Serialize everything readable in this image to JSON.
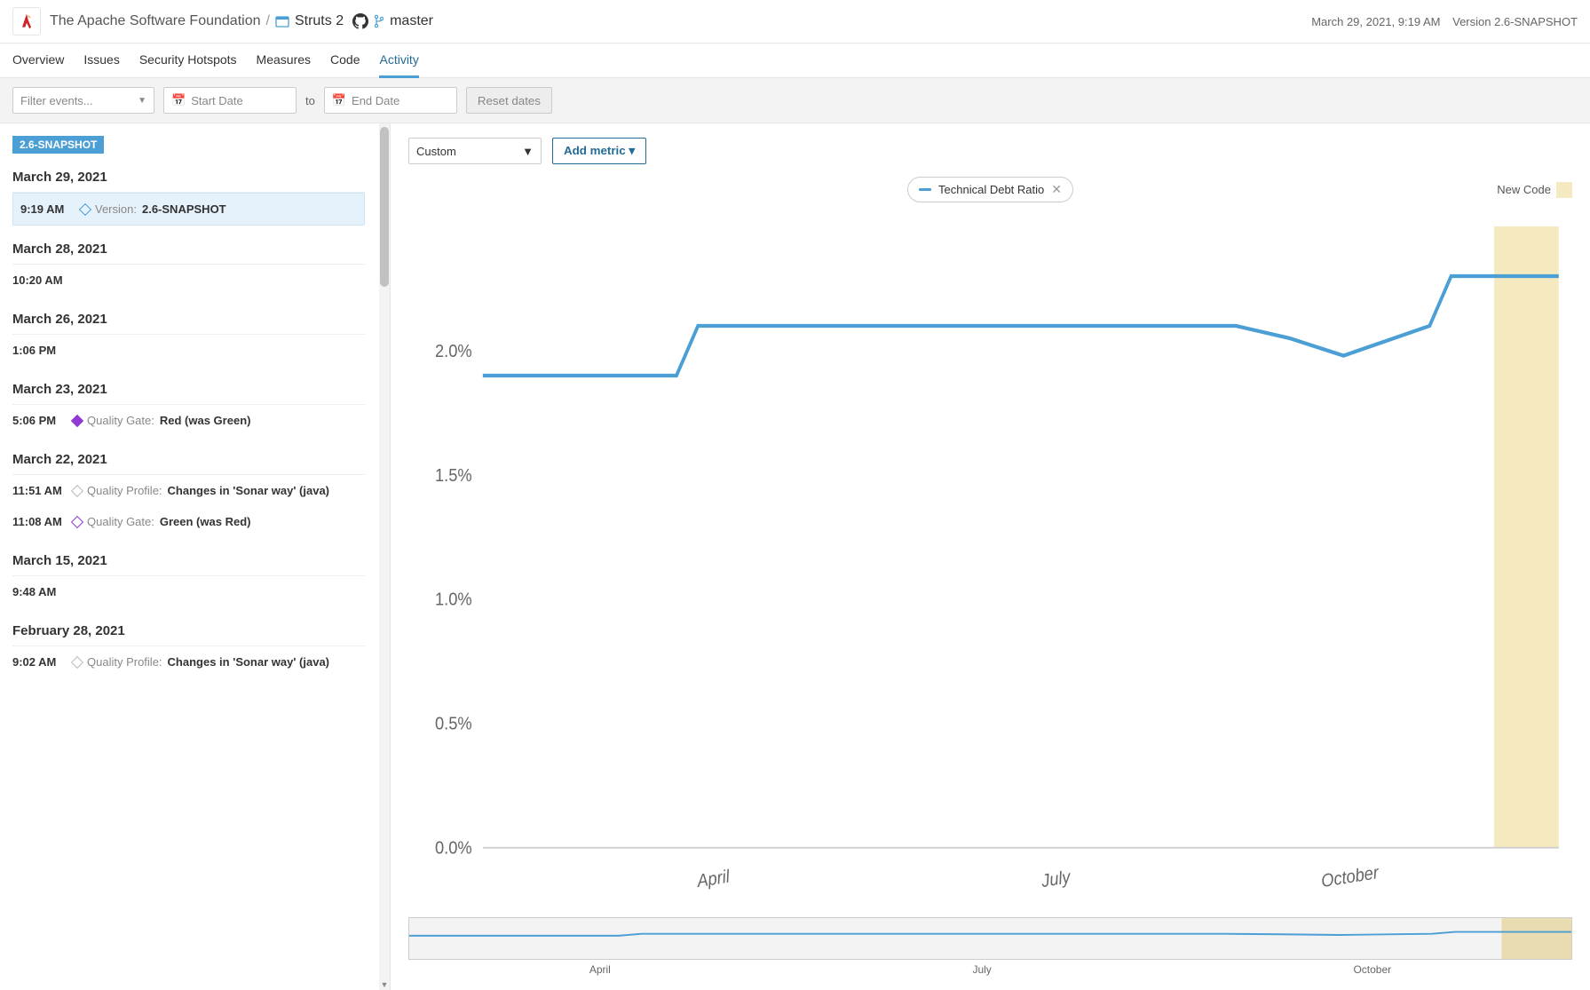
{
  "header": {
    "org": "The Apache Software Foundation",
    "sep": "/",
    "project": "Struts 2",
    "branch": "master",
    "timestamp": "March 29, 2021, 9:19 AM",
    "version_label": "Version 2.6-SNAPSHOT"
  },
  "tabs": [
    "Overview",
    "Issues",
    "Security Hotspots",
    "Measures",
    "Code",
    "Activity"
  ],
  "active_tab": 5,
  "filter": {
    "events_placeholder": "Filter events...",
    "start_placeholder": "Start Date",
    "to": "to",
    "end_placeholder": "End Date",
    "reset": "Reset dates"
  },
  "sidebar": {
    "snapshot_badge": "2.6-SNAPSHOT",
    "days": [
      {
        "date": "March 29, 2021",
        "events": [
          {
            "time": "9:19 AM",
            "diamond": "blue",
            "label": "Version:",
            "value": "2.6-SNAPSHOT",
            "selected": true
          }
        ]
      },
      {
        "date": "March 28, 2021",
        "events": [
          {
            "time": "10:20 AM"
          }
        ]
      },
      {
        "date": "March 26, 2021",
        "events": [
          {
            "time": "1:06 PM"
          }
        ]
      },
      {
        "date": "March 23, 2021",
        "events": [
          {
            "time": "5:06 PM",
            "diamond": "purple",
            "label": "Quality Gate:",
            "value": "Red (was Green)"
          }
        ]
      },
      {
        "date": "March 22, 2021",
        "events": [
          {
            "time": "11:51 AM",
            "diamond": "gray",
            "label": "Quality Profile:",
            "value": "Changes in 'Sonar way' (java)"
          },
          {
            "time": "11:08 AM",
            "diamond": "purple-o",
            "label": "Quality Gate:",
            "value": "Green (was Red)"
          }
        ]
      },
      {
        "date": "March 15, 2021",
        "events": [
          {
            "time": "9:48 AM"
          }
        ]
      },
      {
        "date": "February 28, 2021",
        "events": [
          {
            "time": "9:02 AM",
            "diamond": "gray",
            "label": "Quality Profile:",
            "value": "Changes in 'Sonar way' (java)"
          }
        ]
      }
    ]
  },
  "main": {
    "custom_label": "Custom",
    "add_metric": "Add metric",
    "chip_label": "Technical Debt Ratio",
    "newcode_label": "New Code"
  },
  "chart_data": {
    "type": "line",
    "title": "Technical Debt Ratio",
    "ylabel": "",
    "xlabel": "",
    "y_ticks": [
      "0.0%",
      "0.5%",
      "1.0%",
      "1.5%",
      "2.0%"
    ],
    "ylim": [
      0,
      2.5
    ],
    "x_ticks": [
      "April",
      "July",
      "October"
    ],
    "new_code_start_frac": 0.94,
    "series": [
      {
        "name": "Technical Debt Ratio",
        "color": "#4b9fd5",
        "points": [
          {
            "xf": 0.0,
            "y": 1.9
          },
          {
            "xf": 0.18,
            "y": 1.9
          },
          {
            "xf": 0.2,
            "y": 2.1
          },
          {
            "xf": 0.7,
            "y": 2.1
          },
          {
            "xf": 0.75,
            "y": 2.05
          },
          {
            "xf": 0.8,
            "y": 1.98
          },
          {
            "xf": 0.88,
            "y": 2.1
          },
          {
            "xf": 0.9,
            "y": 2.3
          },
          {
            "xf": 1.0,
            "y": 2.3
          }
        ]
      }
    ],
    "mini_x_ticks": [
      "April",
      "July",
      "October"
    ]
  }
}
